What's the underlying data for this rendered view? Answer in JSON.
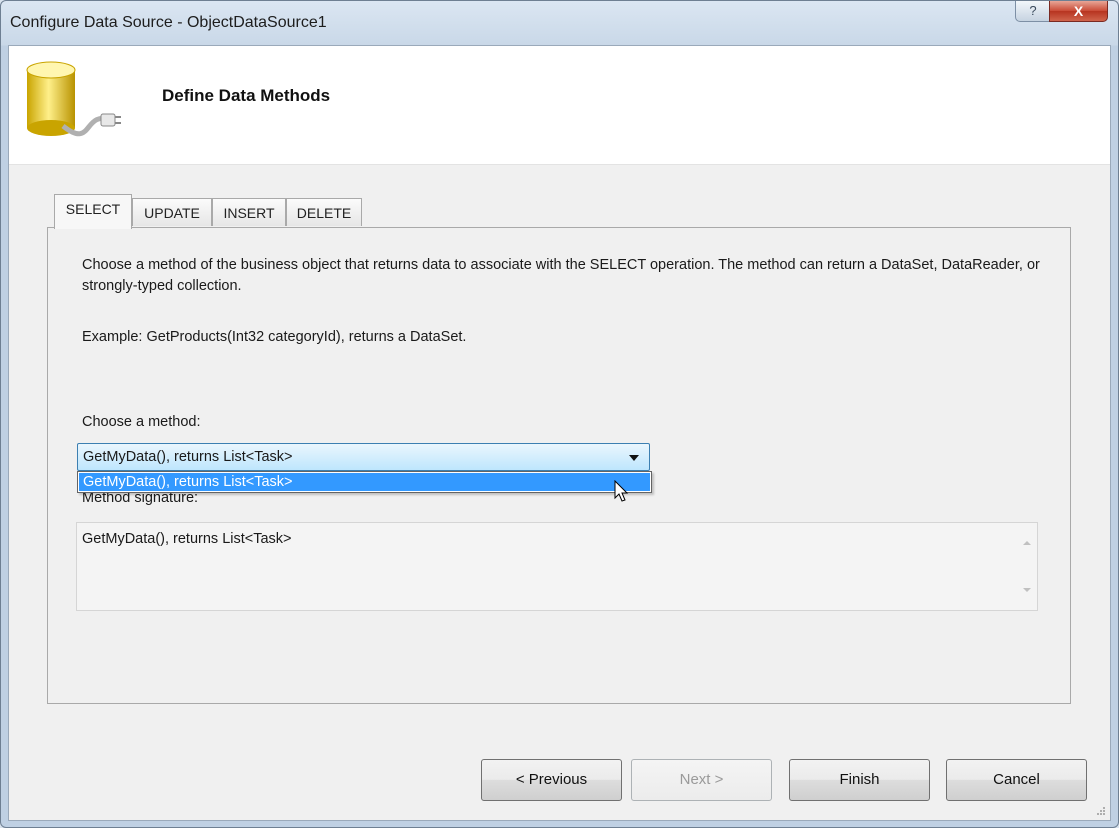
{
  "window": {
    "title": "Configure Data Source - ObjectDataSource1",
    "help_glyph": "?",
    "close_glyph": "X"
  },
  "header": {
    "title": "Define Data Methods",
    "icon": "database-plug-icon"
  },
  "tabs": [
    {
      "label": "SELECT",
      "active": true
    },
    {
      "label": "UPDATE",
      "active": false
    },
    {
      "label": "INSERT",
      "active": false
    },
    {
      "label": "DELETE",
      "active": false
    }
  ],
  "panel": {
    "description": "Choose a method of the business object that returns data to associate with the SELECT operation. The method can return a DataSet, DataReader, or strongly-typed collection.",
    "example": "Example: GetProducts(Int32 categoryId), returns a DataSet.",
    "choose_label": "Choose a method:",
    "method_select": {
      "value": "GetMyData(), returns List<Task>",
      "open": true,
      "options": [
        "GetMyData(), returns List<Task>"
      ]
    },
    "signature_label": "Method signature:",
    "signature_value": "GetMyData(), returns List<Task>"
  },
  "buttons": {
    "previous": "< Previous",
    "next": "Next >",
    "finish": "Finish",
    "cancel": "Cancel"
  },
  "colors": {
    "selection": "#3399ff",
    "select_border": "#3c7fb1",
    "close_button": "#c94a35"
  }
}
